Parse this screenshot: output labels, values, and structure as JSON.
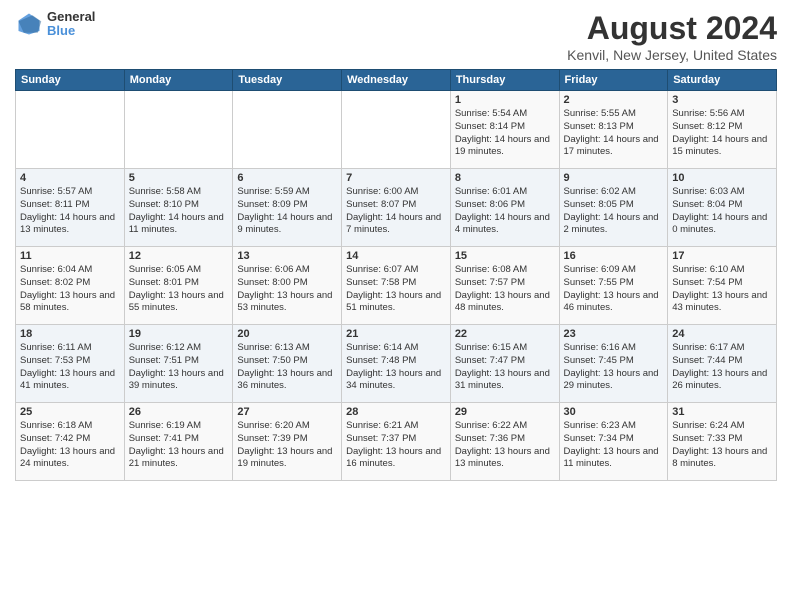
{
  "header": {
    "logo_line1": "General",
    "logo_line2": "Blue",
    "title": "August 2024",
    "subtitle": "Kenvil, New Jersey, United States"
  },
  "weekdays": [
    "Sunday",
    "Monday",
    "Tuesday",
    "Wednesday",
    "Thursday",
    "Friday",
    "Saturday"
  ],
  "weeks": [
    [
      {
        "day": "",
        "info": ""
      },
      {
        "day": "",
        "info": ""
      },
      {
        "day": "",
        "info": ""
      },
      {
        "day": "",
        "info": ""
      },
      {
        "day": "1",
        "info": "Sunrise: 5:54 AM\nSunset: 8:14 PM\nDaylight: 14 hours\nand 19 minutes."
      },
      {
        "day": "2",
        "info": "Sunrise: 5:55 AM\nSunset: 8:13 PM\nDaylight: 14 hours\nand 17 minutes."
      },
      {
        "day": "3",
        "info": "Sunrise: 5:56 AM\nSunset: 8:12 PM\nDaylight: 14 hours\nand 15 minutes."
      }
    ],
    [
      {
        "day": "4",
        "info": "Sunrise: 5:57 AM\nSunset: 8:11 PM\nDaylight: 14 hours\nand 13 minutes."
      },
      {
        "day": "5",
        "info": "Sunrise: 5:58 AM\nSunset: 8:10 PM\nDaylight: 14 hours\nand 11 minutes."
      },
      {
        "day": "6",
        "info": "Sunrise: 5:59 AM\nSunset: 8:09 PM\nDaylight: 14 hours\nand 9 minutes."
      },
      {
        "day": "7",
        "info": "Sunrise: 6:00 AM\nSunset: 8:07 PM\nDaylight: 14 hours\nand 7 minutes."
      },
      {
        "day": "8",
        "info": "Sunrise: 6:01 AM\nSunset: 8:06 PM\nDaylight: 14 hours\nand 4 minutes."
      },
      {
        "day": "9",
        "info": "Sunrise: 6:02 AM\nSunset: 8:05 PM\nDaylight: 14 hours\nand 2 minutes."
      },
      {
        "day": "10",
        "info": "Sunrise: 6:03 AM\nSunset: 8:04 PM\nDaylight: 14 hours\nand 0 minutes."
      }
    ],
    [
      {
        "day": "11",
        "info": "Sunrise: 6:04 AM\nSunset: 8:02 PM\nDaylight: 13 hours\nand 58 minutes."
      },
      {
        "day": "12",
        "info": "Sunrise: 6:05 AM\nSunset: 8:01 PM\nDaylight: 13 hours\nand 55 minutes."
      },
      {
        "day": "13",
        "info": "Sunrise: 6:06 AM\nSunset: 8:00 PM\nDaylight: 13 hours\nand 53 minutes."
      },
      {
        "day": "14",
        "info": "Sunrise: 6:07 AM\nSunset: 7:58 PM\nDaylight: 13 hours\nand 51 minutes."
      },
      {
        "day": "15",
        "info": "Sunrise: 6:08 AM\nSunset: 7:57 PM\nDaylight: 13 hours\nand 48 minutes."
      },
      {
        "day": "16",
        "info": "Sunrise: 6:09 AM\nSunset: 7:55 PM\nDaylight: 13 hours\nand 46 minutes."
      },
      {
        "day": "17",
        "info": "Sunrise: 6:10 AM\nSunset: 7:54 PM\nDaylight: 13 hours\nand 43 minutes."
      }
    ],
    [
      {
        "day": "18",
        "info": "Sunrise: 6:11 AM\nSunset: 7:53 PM\nDaylight: 13 hours\nand 41 minutes."
      },
      {
        "day": "19",
        "info": "Sunrise: 6:12 AM\nSunset: 7:51 PM\nDaylight: 13 hours\nand 39 minutes."
      },
      {
        "day": "20",
        "info": "Sunrise: 6:13 AM\nSunset: 7:50 PM\nDaylight: 13 hours\nand 36 minutes."
      },
      {
        "day": "21",
        "info": "Sunrise: 6:14 AM\nSunset: 7:48 PM\nDaylight: 13 hours\nand 34 minutes."
      },
      {
        "day": "22",
        "info": "Sunrise: 6:15 AM\nSunset: 7:47 PM\nDaylight: 13 hours\nand 31 minutes."
      },
      {
        "day": "23",
        "info": "Sunrise: 6:16 AM\nSunset: 7:45 PM\nDaylight: 13 hours\nand 29 minutes."
      },
      {
        "day": "24",
        "info": "Sunrise: 6:17 AM\nSunset: 7:44 PM\nDaylight: 13 hours\nand 26 minutes."
      }
    ],
    [
      {
        "day": "25",
        "info": "Sunrise: 6:18 AM\nSunset: 7:42 PM\nDaylight: 13 hours\nand 24 minutes."
      },
      {
        "day": "26",
        "info": "Sunrise: 6:19 AM\nSunset: 7:41 PM\nDaylight: 13 hours\nand 21 minutes."
      },
      {
        "day": "27",
        "info": "Sunrise: 6:20 AM\nSunset: 7:39 PM\nDaylight: 13 hours\nand 19 minutes."
      },
      {
        "day": "28",
        "info": "Sunrise: 6:21 AM\nSunset: 7:37 PM\nDaylight: 13 hours\nand 16 minutes."
      },
      {
        "day": "29",
        "info": "Sunrise: 6:22 AM\nSunset: 7:36 PM\nDaylight: 13 hours\nand 13 minutes."
      },
      {
        "day": "30",
        "info": "Sunrise: 6:23 AM\nSunset: 7:34 PM\nDaylight: 13 hours\nand 11 minutes."
      },
      {
        "day": "31",
        "info": "Sunrise: 6:24 AM\nSunset: 7:33 PM\nDaylight: 13 hours\nand 8 minutes."
      }
    ]
  ]
}
